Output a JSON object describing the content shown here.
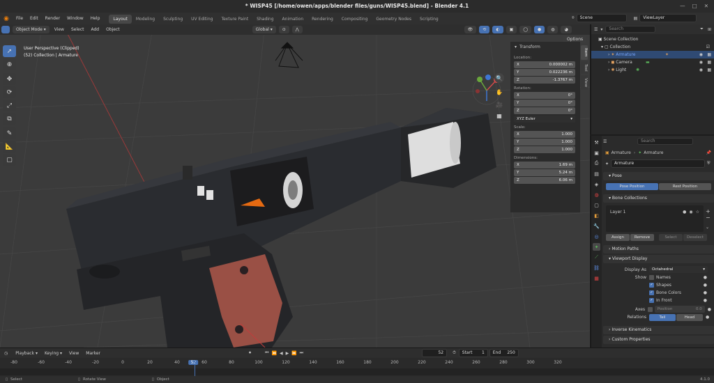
{
  "window": {
    "title": "* WISP45 [/home/owen/apps/blender files/guns/WISP45.blend] - Blender 4.1"
  },
  "menu": [
    "File",
    "Edit",
    "Render",
    "Window",
    "Help"
  ],
  "workspaces": [
    "Layout",
    "Modeling",
    "Sculpting",
    "UV Editing",
    "Texture Paint",
    "Shading",
    "Animation",
    "Rendering",
    "Compositing",
    "Geometry Nodes",
    "Scripting"
  ],
  "scene": {
    "name": "Scene",
    "view_layer": "ViewLayer"
  },
  "viewport": {
    "mode": "Object Mode",
    "header_menu": [
      "View",
      "Select",
      "Add",
      "Object"
    ],
    "orientation": "Global",
    "options_label": "Options",
    "overlay_line1": "User Perspective (Clipped)",
    "overlay_line2": "(52) Collection | Armature",
    "side_tabs": [
      "Item",
      "Tool",
      "View"
    ]
  },
  "transform": {
    "title": "Transform",
    "location_label": "Location:",
    "location": [
      {
        "axis": "X",
        "value": "0.000002 m"
      },
      {
        "axis": "Y",
        "value": "0.022236 m"
      },
      {
        "axis": "Z",
        "value": "-1.3767 m"
      }
    ],
    "rotation_label": "Rotation:",
    "rotation": [
      {
        "axis": "X",
        "value": "0°"
      },
      {
        "axis": "Y",
        "value": "0°"
      },
      {
        "axis": "Z",
        "value": "0°"
      }
    ],
    "rotation_mode": "XYZ Euler",
    "scale_label": "Scale:",
    "scale": [
      {
        "axis": "X",
        "value": "1.000"
      },
      {
        "axis": "Y",
        "value": "1.000"
      },
      {
        "axis": "Z",
        "value": "1.000"
      }
    ],
    "dimensions_label": "Dimensions:",
    "dimensions": [
      {
        "axis": "X",
        "value": "1.69 m"
      },
      {
        "axis": "Y",
        "value": "5.24 m"
      },
      {
        "axis": "Z",
        "value": "6.06 m"
      }
    ]
  },
  "outliner": {
    "search_placeholder": "Search",
    "items": [
      {
        "label": "Scene Collection"
      },
      {
        "label": "Collection"
      },
      {
        "label": "Armature"
      },
      {
        "label": "Camera"
      },
      {
        "label": "Light"
      }
    ]
  },
  "properties": {
    "search_placeholder": "Search",
    "breadcrumb_object": "Armature",
    "breadcrumb_data": "Armature",
    "data_name": "Armature",
    "pose": {
      "title": "Pose",
      "pose_position": "Pose Position",
      "rest_position": "Rest Position"
    },
    "bone_collections": {
      "title": "Bone Collections",
      "layer": "Layer 1",
      "assign": "Assign",
      "remove": "Remove",
      "select": "Select",
      "deselect": "Deselect"
    },
    "motion_paths": "Motion Paths",
    "viewport_display": {
      "title": "Viewport Display",
      "display_as_label": "Display As",
      "display_as": "Octahedral",
      "show_label": "Show",
      "names": "Names",
      "shapes": "Shapes",
      "bone_colors": "Bone Colors",
      "in_front": "In Front",
      "axes_label": "Axes",
      "position_label": "Position",
      "position_value": "0.0",
      "relations_label": "Relations",
      "tail": "Tail",
      "head": "Head"
    },
    "inverse_kinematics": "Inverse Kinematics",
    "custom_properties": "Custom Properties"
  },
  "timeline": {
    "menu": [
      "Playback",
      "Keying",
      "View",
      "Marker"
    ],
    "current_frame": "52",
    "start_label": "Start",
    "start": "1",
    "end_label": "End",
    "end": "250",
    "ticks": [
      "-80",
      "-60",
      "-40",
      "-20",
      "0",
      "20",
      "40",
      "52",
      "60",
      "80",
      "100",
      "120",
      "140",
      "160",
      "180",
      "200",
      "220",
      "240",
      "260",
      "280",
      "300",
      "320"
    ]
  },
  "status": {
    "select": "Select",
    "rotate": "Rotate View",
    "object": "Object",
    "version": "4.1.0"
  },
  "colors": {
    "accent": "#4772b3",
    "selected_row": "#2f4a73",
    "wood_grip": "#9a5045",
    "gun_body": "#2a2c30"
  }
}
